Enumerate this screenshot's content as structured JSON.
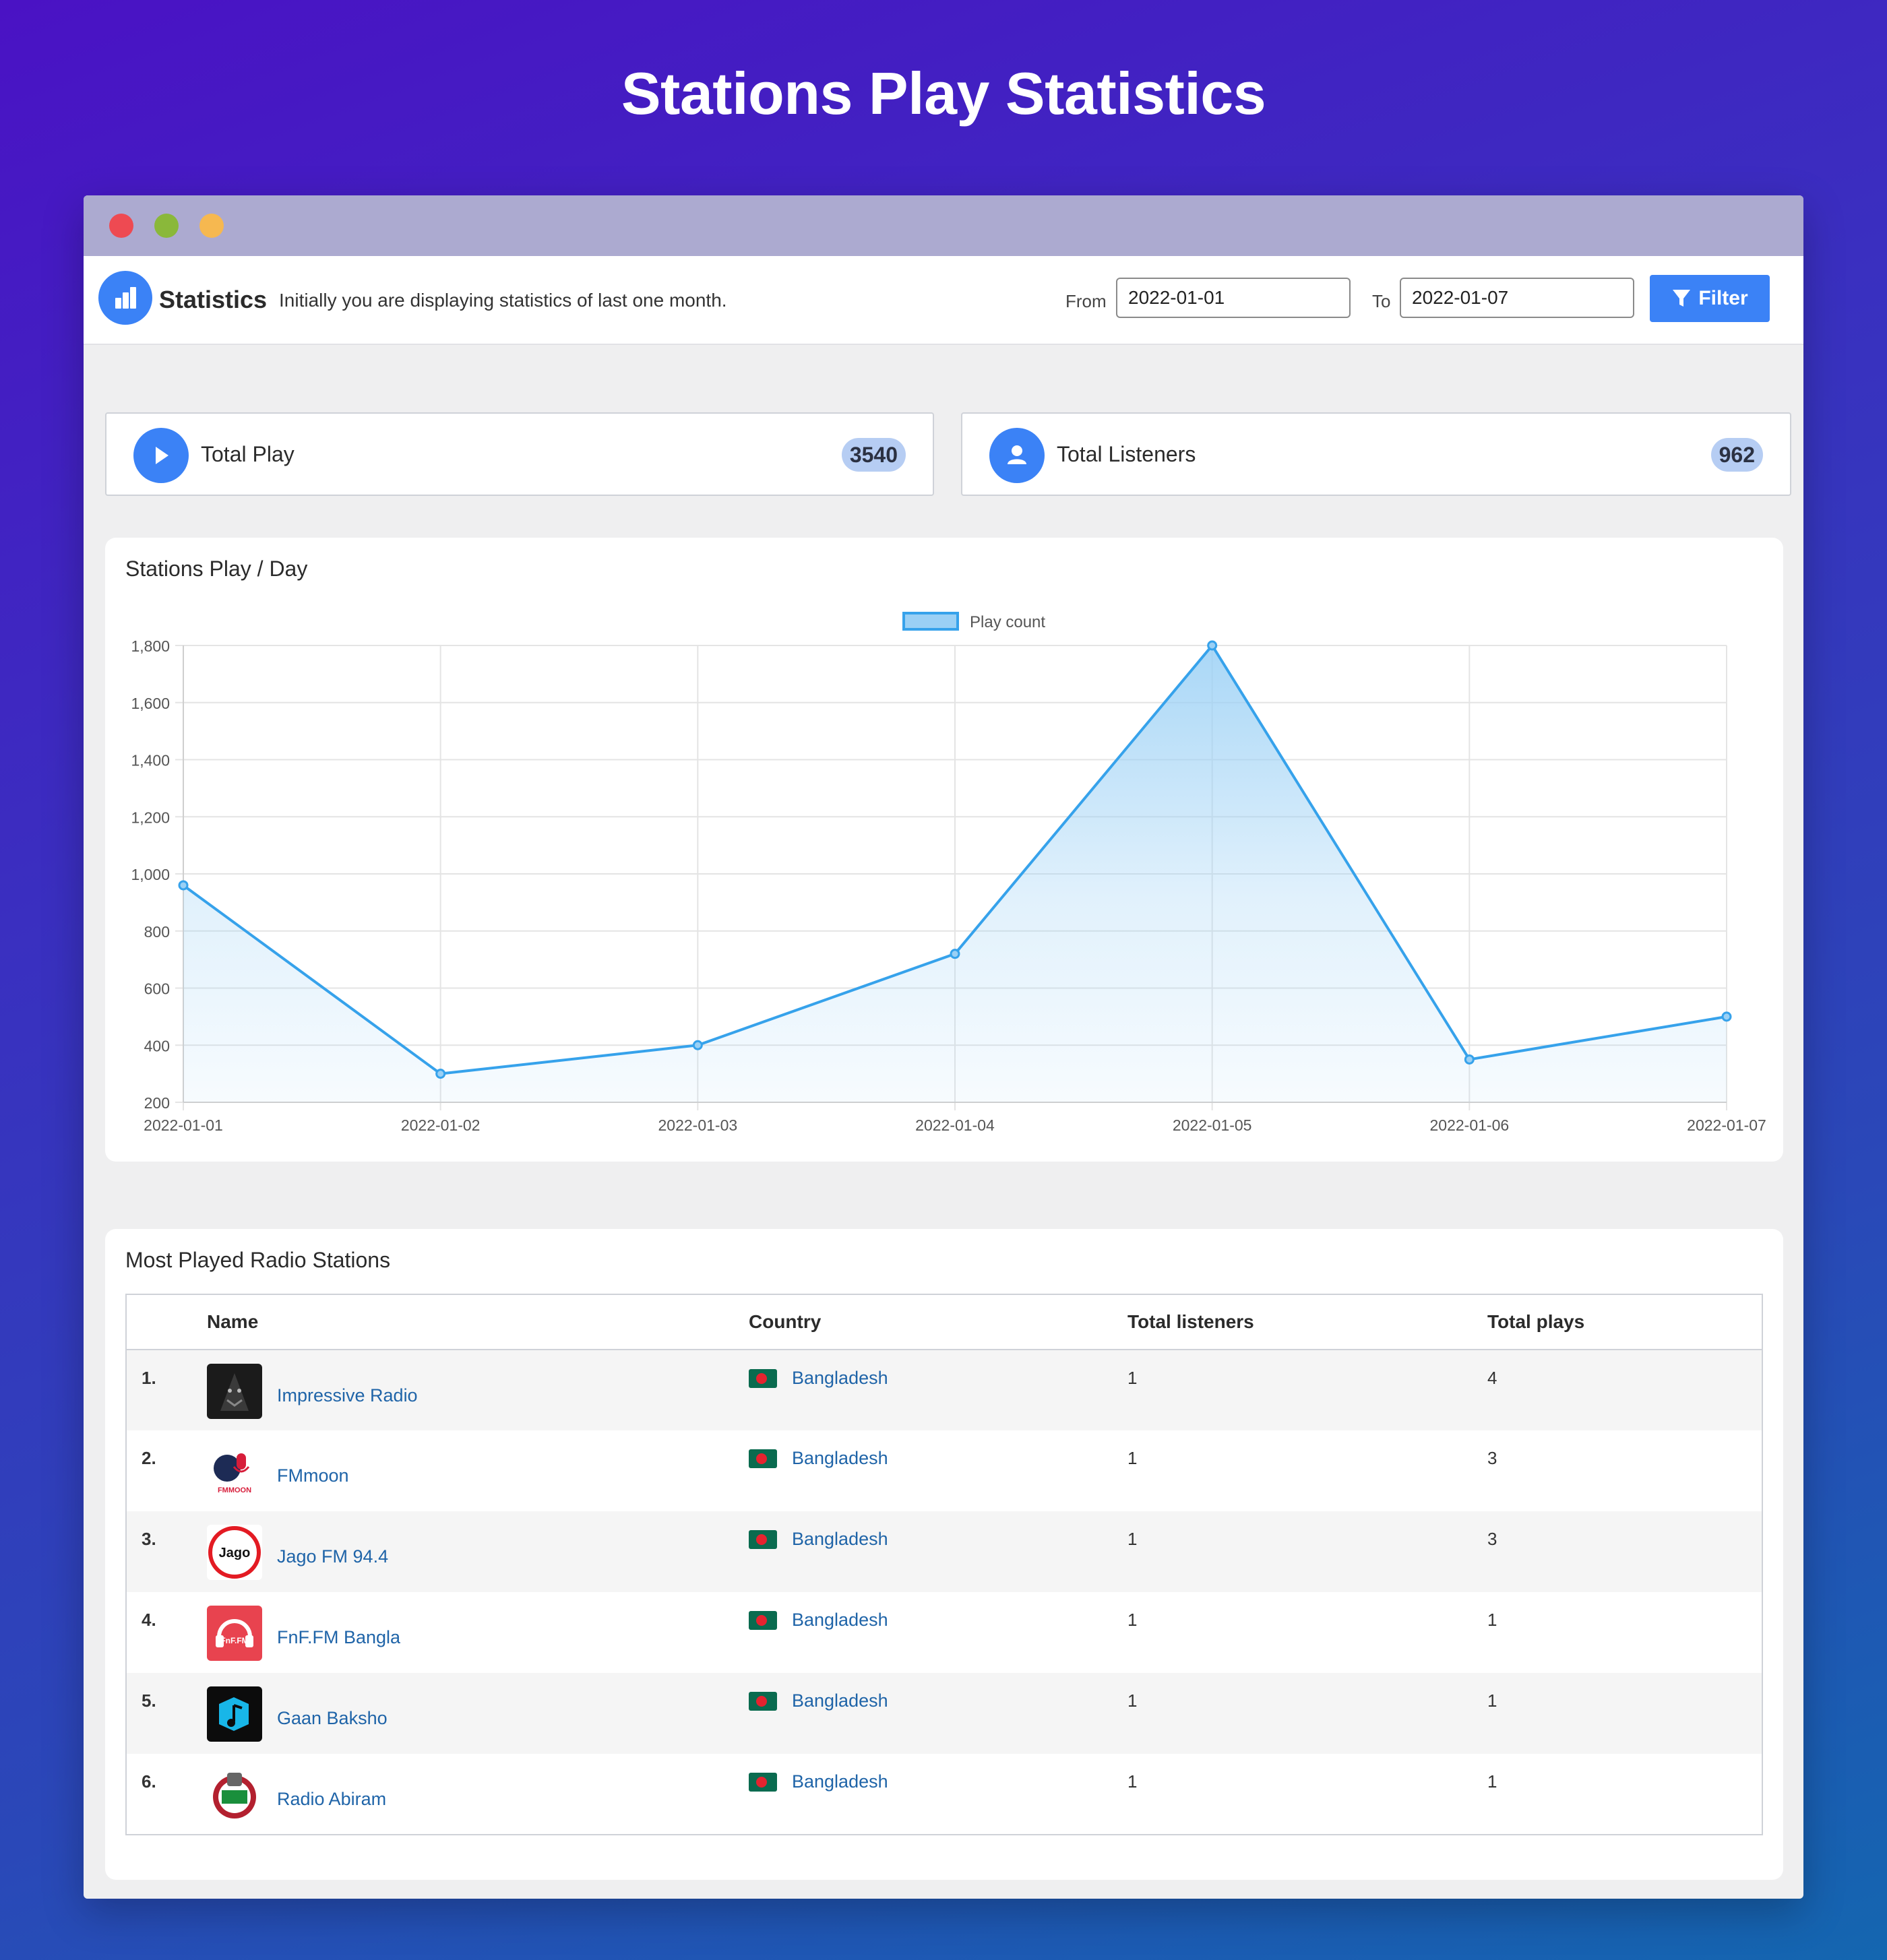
{
  "page": {
    "title": "Stations Play Statistics"
  },
  "header": {
    "title": "Statistics",
    "subtitle": "Initially you are displaying statistics of last one month.",
    "from_label": "From",
    "from_value": "2022-01-01",
    "to_label": "To",
    "to_value": "2022-01-07",
    "filter_label": "Filter"
  },
  "stats": {
    "total_play_label": "Total Play",
    "total_play_value": "3540",
    "total_listeners_label": "Total Listeners",
    "total_listeners_value": "962"
  },
  "chart_panel": {
    "title": "Stations Play / Day"
  },
  "chart_data": {
    "type": "area",
    "title": "",
    "xlabel": "",
    "ylabel": "",
    "x": [
      "2022-01-01",
      "2022-01-02",
      "2022-01-03",
      "2022-01-04",
      "2022-01-05",
      "2022-01-06",
      "2022-01-07"
    ],
    "series": [
      {
        "name": "Play count",
        "values": [
          960,
          300,
          400,
          720,
          1800,
          350,
          500
        ]
      }
    ],
    "ylim": [
      200,
      1800
    ],
    "yticks": [
      200,
      400,
      600,
      800,
      1000,
      1200,
      1400,
      1600,
      1800
    ],
    "ytick_labels": [
      "200",
      "400",
      "600",
      "800",
      "1,000",
      "1,200",
      "1,400",
      "1,600",
      "1,800"
    ],
    "grid": true,
    "legend": "top-center",
    "line_color": "#36a2eb",
    "fill_color": "#9ad0f5"
  },
  "table_panel": {
    "title": "Most Played Radio Stations"
  },
  "table": {
    "columns": [
      "",
      "Name",
      "Country",
      "Total listeners",
      "Total plays"
    ],
    "rows": [
      {
        "rank": "1.",
        "name": "Impressive Radio",
        "country": "Bangladesh",
        "listeners": "1",
        "plays": "4"
      },
      {
        "rank": "2.",
        "name": "FMmoon",
        "country": "Bangladesh",
        "listeners": "1",
        "plays": "3"
      },
      {
        "rank": "3.",
        "name": "Jago FM 94.4",
        "country": "Bangladesh",
        "listeners": "1",
        "plays": "3"
      },
      {
        "rank": "4.",
        "name": "FnF.FM Bangla",
        "country": "Bangladesh",
        "listeners": "1",
        "plays": "1"
      },
      {
        "rank": "5.",
        "name": "Gaan Baksho",
        "country": "Bangladesh",
        "listeners": "1",
        "plays": "1"
      },
      {
        "rank": "6.",
        "name": "Radio Abiram",
        "country": "Bangladesh",
        "listeners": "1",
        "plays": "1"
      }
    ]
  },
  "colors": {
    "accent": "#3b82f6",
    "link": "#1f64a8"
  }
}
